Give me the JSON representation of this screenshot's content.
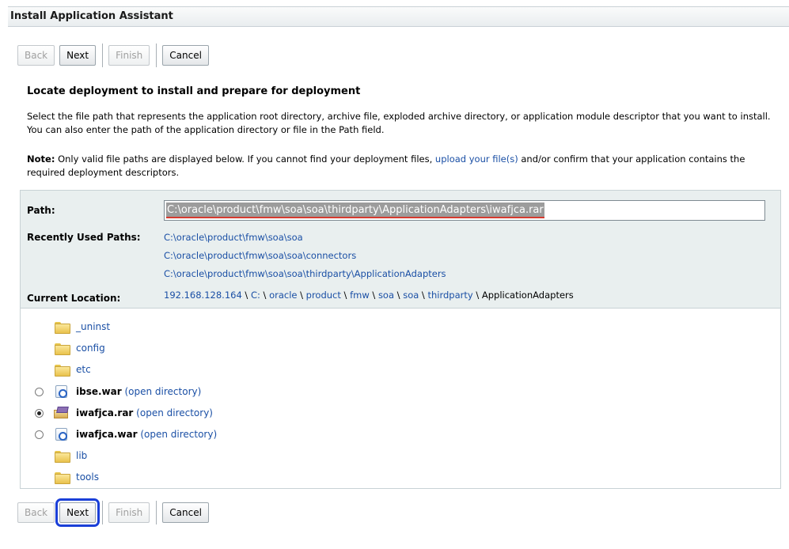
{
  "title": "Install Application Assistant",
  "buttons": {
    "back": "Back",
    "next": "Next",
    "finish": "Finish",
    "cancel": "Cancel"
  },
  "heading": "Locate deployment to install and prepare for deployment",
  "description": "Select the file path that represents the application root directory, archive file, exploded archive directory, or application module descriptor that you want to install. You can also enter the path of the application directory or file in the Path field.",
  "note": {
    "label": "Note:",
    "text_before": " Only valid file paths are displayed below. If you cannot find your deployment files, ",
    "link": "upload your file(s)",
    "text_after": " and/or confirm that your application contains the required deployment descriptors."
  },
  "path": {
    "label": "Path:",
    "value": "C:\\oracle\\product\\fmw\\soa\\soa\\thirdparty\\ApplicationAdapters\\iwafjca.rar"
  },
  "recent": {
    "label": "Recently Used Paths:",
    "items": [
      "C:\\oracle\\product\\fmw\\soa\\soa",
      "C:\\oracle\\product\\fmw\\soa\\soa\\connectors",
      "C:\\oracle\\product\\fmw\\soa\\soa\\thirdparty\\ApplicationAdapters"
    ]
  },
  "location": {
    "label": "Current Location:",
    "crumbs": [
      "192.168.128.164",
      "C:",
      "oracle",
      "product",
      "fmw",
      "soa",
      "soa",
      "thirdparty"
    ],
    "current": "ApplicationAdapters",
    "separator": " \\ "
  },
  "tree": {
    "open_label": "(open directory)",
    "items": [
      {
        "name": "_uninst",
        "kind": "folder"
      },
      {
        "name": "config",
        "kind": "folder"
      },
      {
        "name": "etc",
        "kind": "folder"
      },
      {
        "name": "ibse.war",
        "kind": "archive",
        "selected": false
      },
      {
        "name": "iwafjca.rar",
        "kind": "rar",
        "selected": true
      },
      {
        "name": "iwafjca.war",
        "kind": "archive",
        "selected": false
      },
      {
        "name": "lib",
        "kind": "folder"
      },
      {
        "name": "tools",
        "kind": "folder"
      }
    ]
  },
  "colors": {
    "link": "#1a4fa5",
    "panel_bg": "#e9efef",
    "highlight": "#1a3fd8"
  }
}
